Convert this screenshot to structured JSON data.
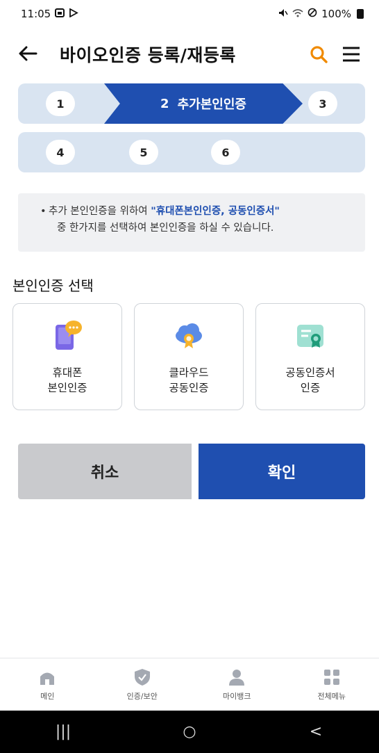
{
  "status_bar": {
    "time": "11:05",
    "battery": "100%",
    "icons_left": [
      "gallery-icon",
      "play-icon"
    ],
    "icons_right": [
      "mute-icon",
      "wifi-icon",
      "alarm-icon",
      "battery-icon"
    ]
  },
  "header": {
    "title": "바이오인증 등록/재등록",
    "accent_color": "#f08a00"
  },
  "steps": {
    "row1": [
      {
        "number": "1"
      },
      {
        "number": "2",
        "label": "추가본인인증",
        "active": true
      },
      {
        "number": "3"
      }
    ],
    "row2": [
      {
        "number": "4"
      },
      {
        "number": "5"
      },
      {
        "number": "6"
      }
    ],
    "active_color": "#1f4fb0",
    "inactive_color": "#d9e4f1"
  },
  "notice": {
    "bullet": "•",
    "prefix": "추가 본인인증을 위하여 ",
    "highlight": "\"휴대폰본인인증, 공동인증서\"",
    "line2": "중 한가지를 선택하여 본인인증을 하실 수 있습니다."
  },
  "section_title": "본인인증 선택",
  "auth_options": [
    {
      "line1": "휴대폰",
      "line2": "본인인증",
      "icon": "phone-chat-icon"
    },
    {
      "line1": "클라우드",
      "line2": "공동인증",
      "icon": "cloud-certificate-icon"
    },
    {
      "line1": "공동인증서",
      "line2": "인증",
      "icon": "certificate-icon"
    }
  ],
  "buttons": {
    "cancel": "취소",
    "confirm": "확인"
  },
  "bottom_nav": [
    {
      "label": "메인",
      "icon": "home-icon"
    },
    {
      "label": "인증/보안",
      "icon": "shield-icon"
    },
    {
      "label": "마이뱅크",
      "icon": "person-icon"
    },
    {
      "label": "전체메뉴",
      "icon": "grid-icon"
    }
  ],
  "system_nav": {
    "recent": "|||",
    "home": "○",
    "back": "<"
  }
}
